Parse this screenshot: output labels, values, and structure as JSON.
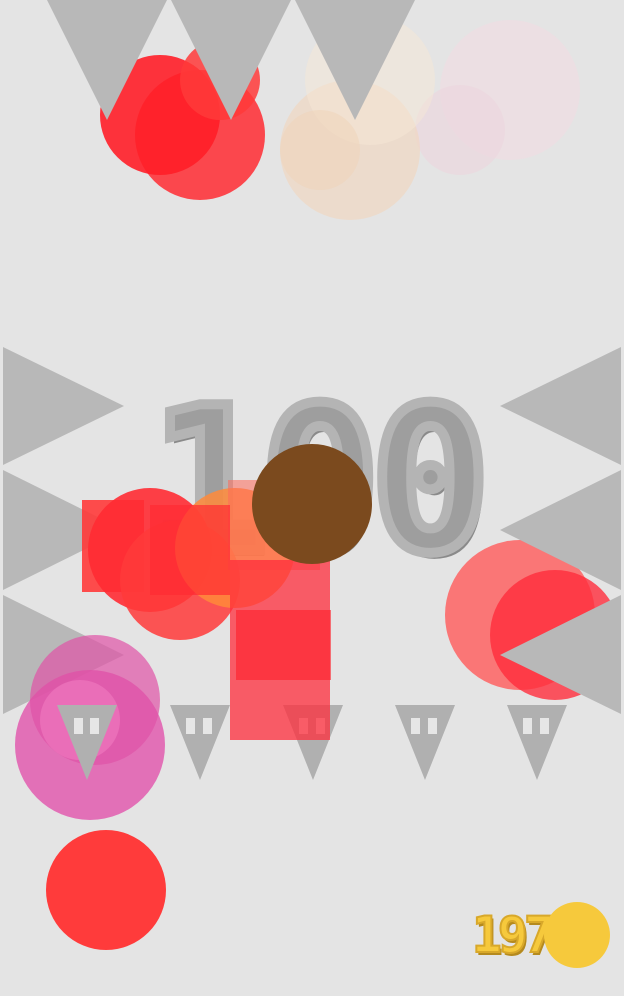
{
  "game": {
    "score": "100",
    "coins": "197"
  },
  "colors": {
    "background": "#e4e4e4",
    "spike": "#b8b8b8",
    "score_text": "#9e9e9e",
    "coin": "#f6c93c",
    "player_red": "#ff1e28",
    "burst_pink": "#e24aa8",
    "burst_orange": "#ff7a2e",
    "burst_brown": "#7b4a1e",
    "burst_peach": "#f2d2b2"
  },
  "icons": {
    "top_spikes": "spike-down-icon",
    "side_spikes": "spike-side-icon",
    "enemy": "arrowhead-enemy-icon",
    "coin": "coin-icon"
  }
}
